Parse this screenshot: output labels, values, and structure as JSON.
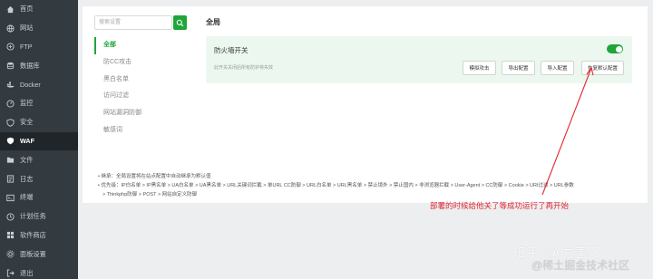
{
  "sidebar": {
    "items": [
      {
        "label": "首页",
        "icon": "home-icon"
      },
      {
        "label": "网站",
        "icon": "globe-icon"
      },
      {
        "label": "FTP",
        "icon": "ftp-icon"
      },
      {
        "label": "数据库",
        "icon": "database-icon"
      },
      {
        "label": "Docker",
        "icon": "docker-icon"
      },
      {
        "label": "监控",
        "icon": "monitor-icon"
      },
      {
        "label": "安全",
        "icon": "shield-icon"
      },
      {
        "label": "WAF",
        "icon": "waf-icon",
        "active": true
      },
      {
        "label": "文件",
        "icon": "folder-icon"
      },
      {
        "label": "日志",
        "icon": "log-icon"
      },
      {
        "label": "终端",
        "icon": "terminal-icon"
      },
      {
        "label": "计划任务",
        "icon": "clock-icon"
      },
      {
        "label": "软件商店",
        "icon": "store-icon"
      },
      {
        "label": "面板设置",
        "icon": "settings-icon"
      },
      {
        "label": "退出",
        "icon": "logout-icon"
      }
    ]
  },
  "search": {
    "placeholder": "搜索设置"
  },
  "submenu": {
    "items": [
      "全部",
      "防CC攻击",
      "黑白名单",
      "访问过滤",
      "网站漏洞防御",
      "敏感词"
    ]
  },
  "main": {
    "section_title": "全局",
    "card": {
      "title": "防火墙开关",
      "description": "此开关关闭后所有防护将失效",
      "enabled": true,
      "buttons": [
        "模拟攻击",
        "导出配置",
        "导入配置",
        "恢复默认配置"
      ]
    },
    "notes": [
      "继承：全局设置将在站点配置中自动继承为默认值",
      "优先级：IP白名单 > IP黑名单 > UA白名单 > UA黑名单 > URL关键词拦截 > 单URL CC防御 > URL白名单 > URL黑名单 > 禁止境外 > 禁止国内 > 非浏览器拦截 > User-Agent > CC防御 > Cookie > URI过滤 > URL参数",
      "> Thinkphp防御 > POST > 网站自定义防御"
    ]
  },
  "annotation": {
    "text": "部署的时候给他关了等成功运行了再开始",
    "color": "#e0282e"
  },
  "watermark": {
    "line1": "知乎 @厉害了",
    "line2": "@稀土掘金技术社区"
  },
  "colors": {
    "accent": "#20a53a",
    "sidebar_bg": "#333a40",
    "card_bg": "#ecf8ef"
  }
}
